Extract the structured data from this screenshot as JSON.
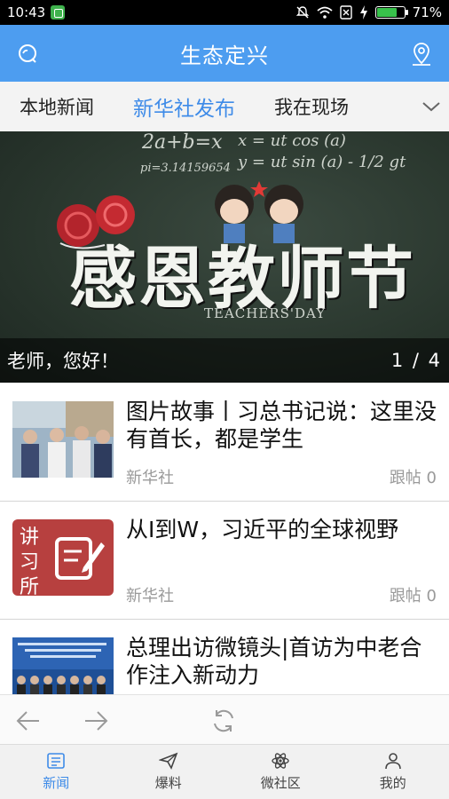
{
  "status_bar": {
    "time": "10:43",
    "battery": "71%",
    "battery_level": 0.71
  },
  "header": {
    "title": "生态定兴"
  },
  "tabs": [
    {
      "label": "本地新闻",
      "active": false
    },
    {
      "label": "新华社发布",
      "active": true
    },
    {
      "label": "我在现场",
      "active": false
    }
  ],
  "banner": {
    "caption": "老师，您好！",
    "pager": "1 / 4",
    "image_text": {
      "eq1": "2a+b=x",
      "eq2": "x = ut cos (a)",
      "eq3": "y = ut sin (a) - 1/2 gt",
      "eq4": "pi=3.14159654",
      "main": "感恩教师节",
      "sub": "TEACHERS'DAY"
    }
  },
  "news": [
    {
      "title": "图片故事丨习总书记说：这里没有首长，都是学生",
      "source": "新华社",
      "replies": "跟帖 0"
    },
    {
      "title": "从I到W，习近平的全球视野",
      "source": "新华社",
      "replies": "跟帖 0",
      "thumb_text": [
        "讲",
        "习",
        "所"
      ]
    },
    {
      "title": "总理出访微镜头|首访为中老合作注入新动力",
      "source": "新华社",
      "replies": "跟帖 0"
    }
  ],
  "bottom_nav": [
    {
      "label": "新闻",
      "icon": "news-icon",
      "active": true
    },
    {
      "label": "爆料",
      "icon": "send-icon",
      "active": false
    },
    {
      "label": "微社区",
      "icon": "atom-icon",
      "active": false
    },
    {
      "label": "我的",
      "icon": "user-icon",
      "active": false
    }
  ],
  "colors": {
    "accent": "#4d9df0",
    "tab_active": "#3e8be8",
    "text_muted": "#9a9a9a"
  }
}
